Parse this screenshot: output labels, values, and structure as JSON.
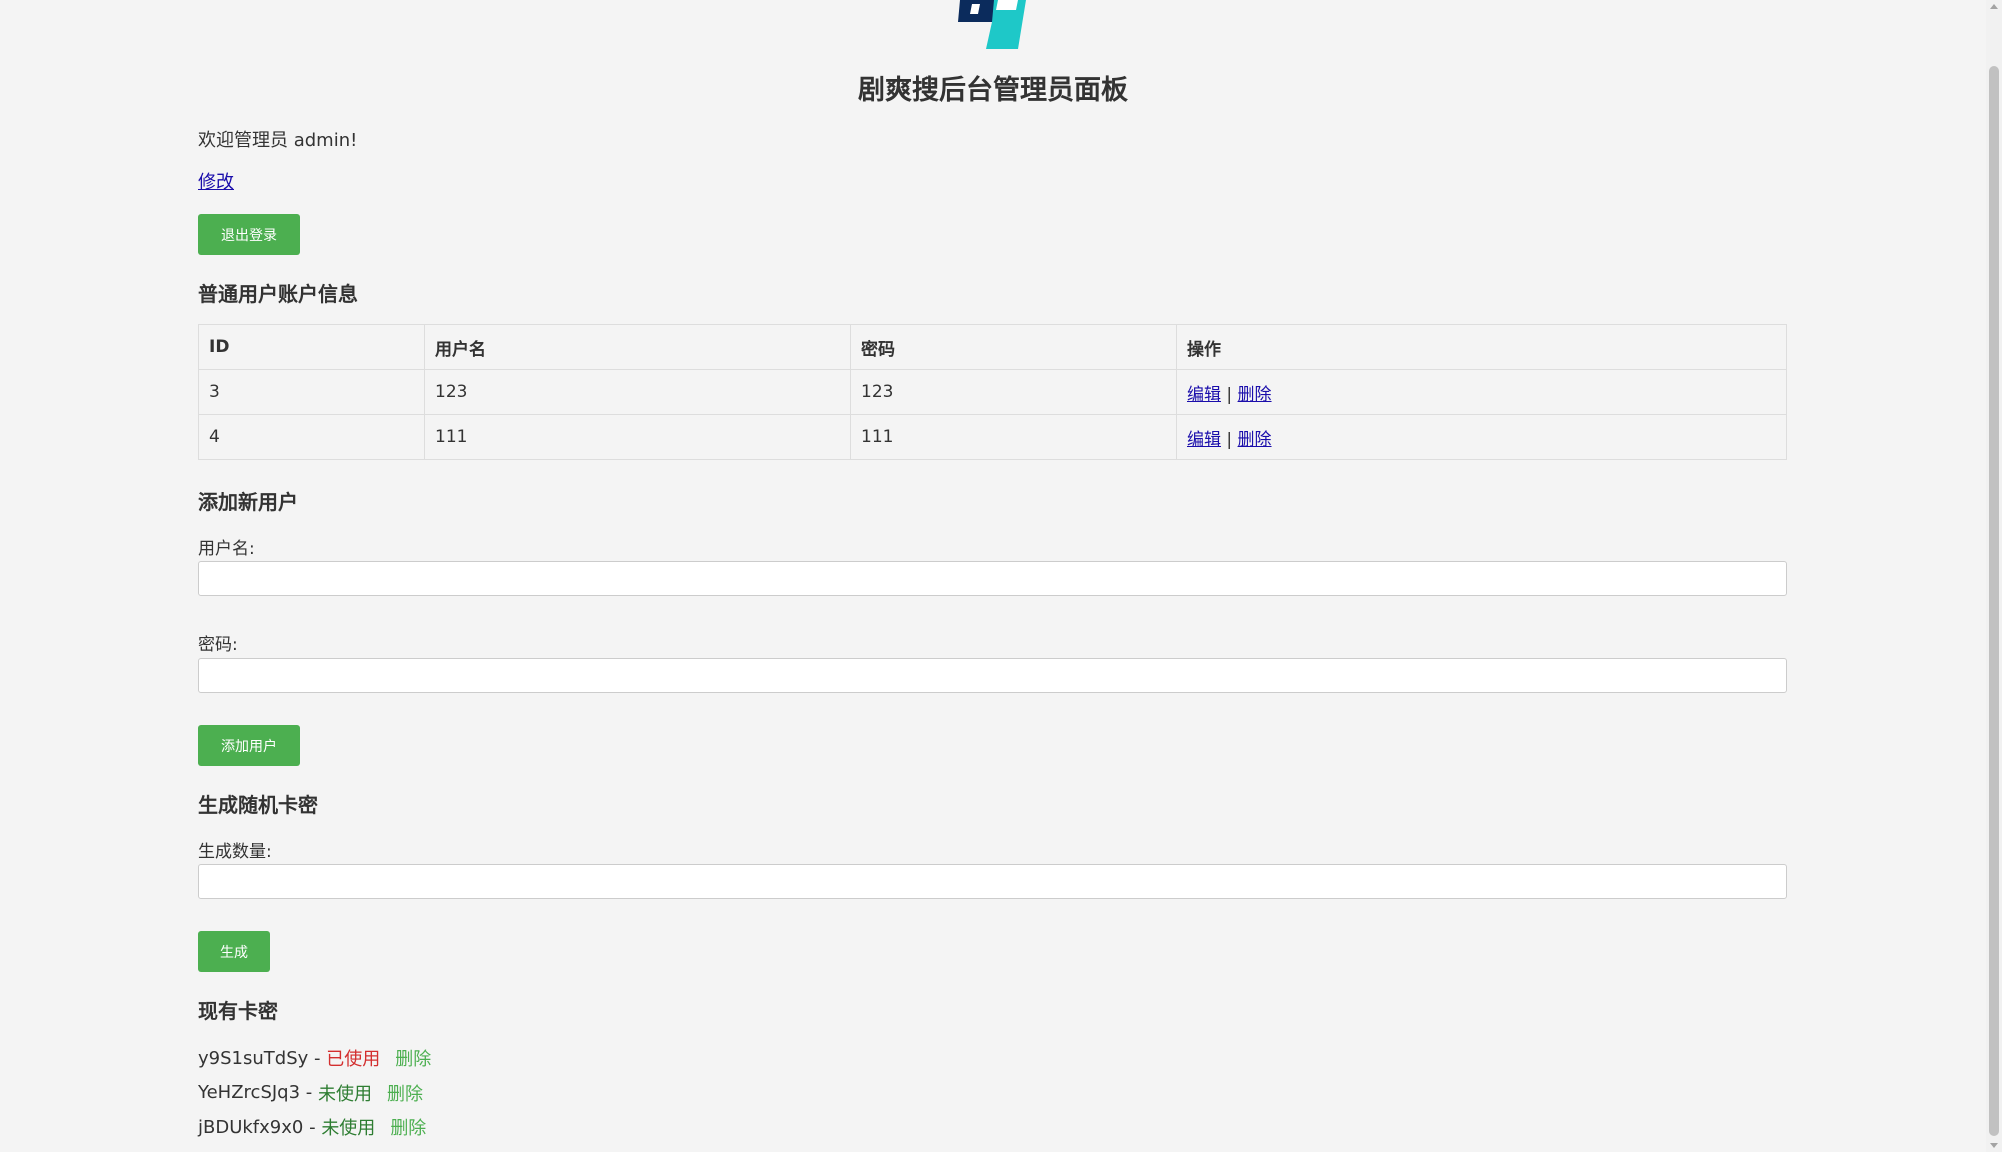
{
  "header": {
    "logo_icon": "logo-icon",
    "title": "剧爽搜后台管理员面板"
  },
  "welcome_text": "欢迎管理员 admin!",
  "modify_link": "修改",
  "logout_button": "退出登录",
  "users_section": {
    "title": "普通用户账户信息",
    "columns": [
      "ID",
      "用户名",
      "密码",
      "操作"
    ],
    "rows": [
      {
        "id": "3",
        "username": "123",
        "password": "123",
        "edit": "编辑",
        "sep": "|",
        "delete": "删除"
      },
      {
        "id": "4",
        "username": "111",
        "password": "111",
        "edit": "编辑",
        "sep": "|",
        "delete": "删除"
      }
    ]
  },
  "add_user": {
    "title": "添加新用户",
    "username_label": "用户名:",
    "username_value": "",
    "password_label": "密码:",
    "password_value": "",
    "button": "添加用户"
  },
  "generate": {
    "title": "生成随机卡密",
    "count_label": "生成数量:",
    "count_value": "",
    "button": "生成"
  },
  "cards": {
    "title": "现有卡密",
    "items": [
      {
        "code": "y9S1suTdSy",
        "sep": " - ",
        "status": "已使用",
        "status_type": "used",
        "delete": "删除"
      },
      {
        "code": "YeHZrcSJq3",
        "sep": " - ",
        "status": "未使用",
        "status_type": "unused",
        "delete": "删除"
      },
      {
        "code": "jBDUkfx9x0",
        "sep": " - ",
        "status": "未使用",
        "status_type": "unused",
        "delete": "删除"
      }
    ]
  },
  "colors": {
    "accent_green": "#4caf50",
    "used_red": "#d32f2f",
    "unused_green": "#2e7d32",
    "link_blue": "#1a0dab",
    "logo_navy": "#0b2b5c",
    "logo_cyan": "#1ec8c8"
  }
}
